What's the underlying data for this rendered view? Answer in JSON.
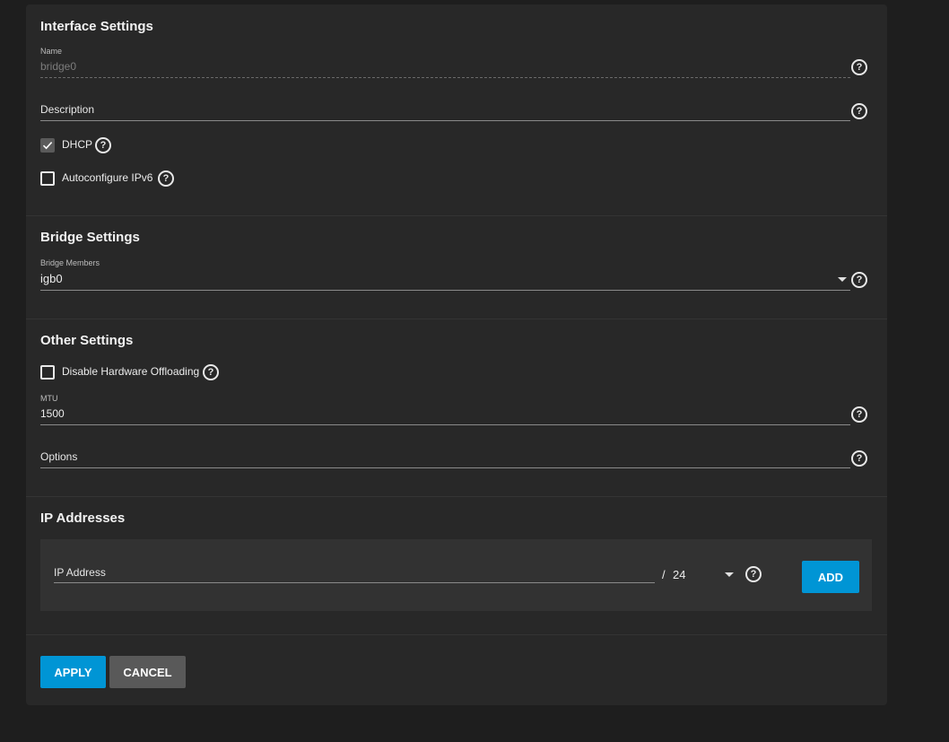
{
  "interface_settings": {
    "title": "Interface Settings",
    "name_label": "Name",
    "name_value": "bridge0",
    "description_placeholder": "Description",
    "dhcp_label": "DHCP",
    "dhcp_checked": true,
    "autoconfig_label": "Autoconfigure IPv6",
    "autoconfig_checked": false
  },
  "bridge_settings": {
    "title": "Bridge Settings",
    "members_label": "Bridge Members",
    "members_value": "igb0"
  },
  "other_settings": {
    "title": "Other Settings",
    "offload_label": "Disable Hardware Offloading",
    "offload_checked": false,
    "mtu_label": "MTU",
    "mtu_value": "1500",
    "options_placeholder": "Options"
  },
  "ip_addresses": {
    "title": "IP Addresses",
    "address_placeholder": "IP Address",
    "separator": "/",
    "netmask_value": "24",
    "add_label": "ADD"
  },
  "actions": {
    "apply_label": "APPLY",
    "cancel_label": "CANCEL"
  },
  "help_glyph": "?",
  "colors": {
    "background": "#1e1e1e",
    "card": "#282828",
    "primary": "#0095d5",
    "secondary": "#595959"
  }
}
